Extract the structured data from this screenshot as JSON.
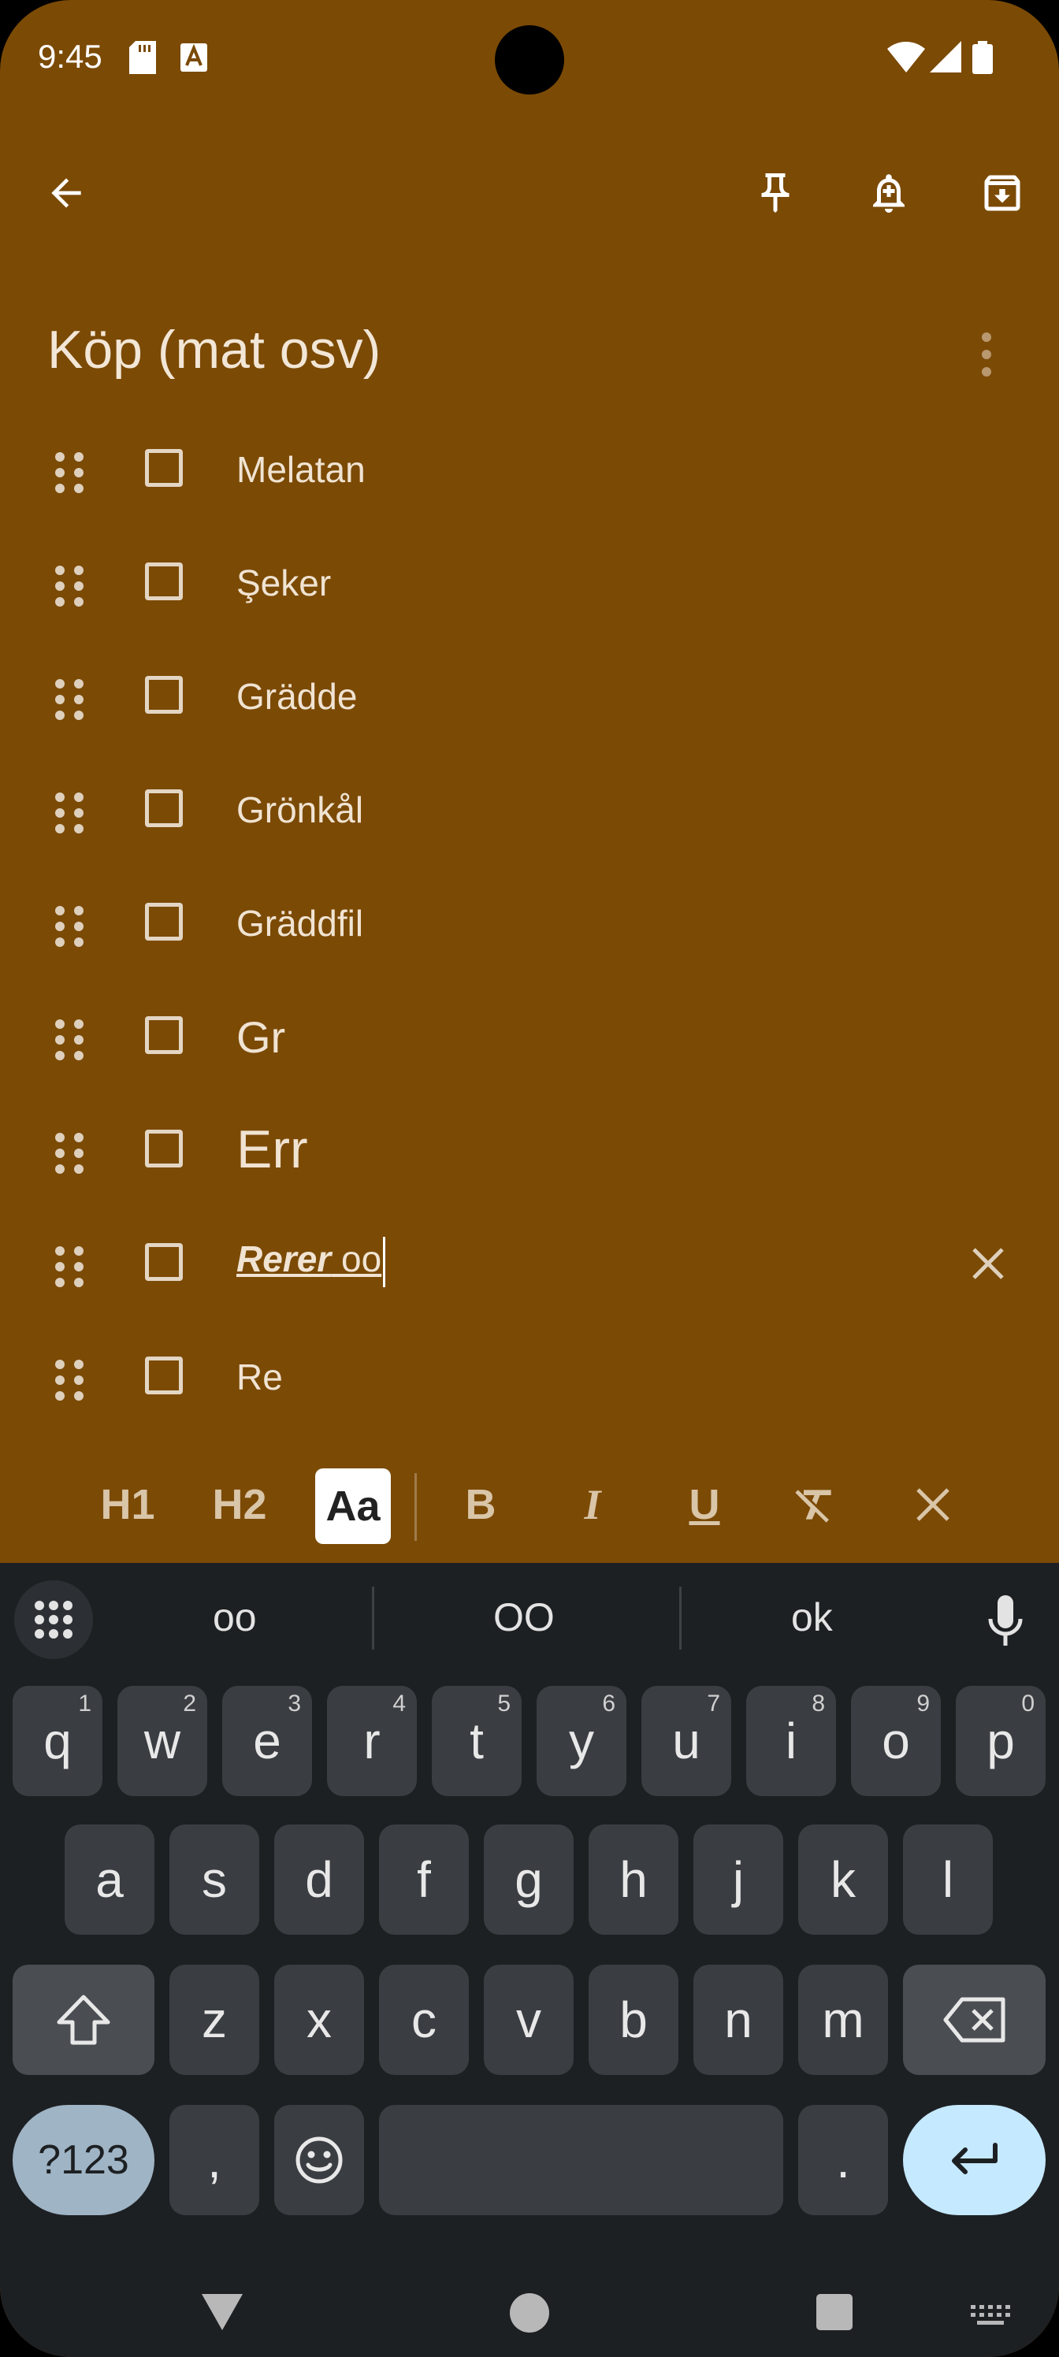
{
  "status_bar": {
    "time": "9:45"
  },
  "note": {
    "title": "Köp (mat osv)",
    "items": [
      {
        "label": "Melatan"
      },
      {
        "label": "Şeker"
      },
      {
        "label": "Grädde"
      },
      {
        "label": "Grönkål"
      },
      {
        "label": "Gräddfil"
      },
      {
        "label": "Gr"
      },
      {
        "label": "Err"
      },
      {
        "label_styled": "Rerer",
        "label_plain": " oo"
      },
      {
        "label": "Re"
      }
    ]
  },
  "format_toolbar": {
    "h1": "H1",
    "h2": "H2",
    "normal": "Aa",
    "bold": "B",
    "italic": "I",
    "underline": "U"
  },
  "keyboard": {
    "suggestions": [
      "oo",
      "OO",
      "ok"
    ],
    "row1": [
      {
        "k": "q",
        "n": "1"
      },
      {
        "k": "w",
        "n": "2"
      },
      {
        "k": "e",
        "n": "3"
      },
      {
        "k": "r",
        "n": "4"
      },
      {
        "k": "t",
        "n": "5"
      },
      {
        "k": "y",
        "n": "6"
      },
      {
        "k": "u",
        "n": "7"
      },
      {
        "k": "i",
        "n": "8"
      },
      {
        "k": "o",
        "n": "9"
      },
      {
        "k": "p",
        "n": "0"
      }
    ],
    "row2": [
      "a",
      "s",
      "d",
      "f",
      "g",
      "h",
      "j",
      "k",
      "l"
    ],
    "row3": [
      "z",
      "x",
      "c",
      "v",
      "b",
      "n",
      "m"
    ],
    "symbols": "?123",
    "comma": ",",
    "period": "."
  }
}
